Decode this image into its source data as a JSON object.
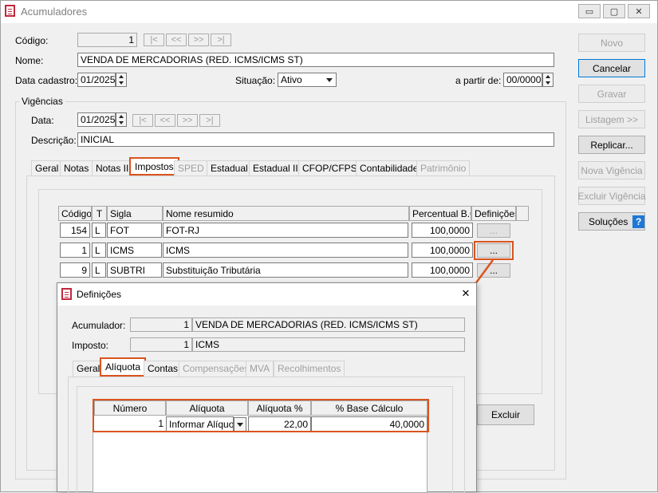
{
  "window": {
    "title": "Acumuladores",
    "controls": [
      "▭",
      "▢",
      "✕"
    ]
  },
  "form": {
    "codigo_label": "Código:",
    "codigo_value": "1",
    "nav_buttons": [
      "|<",
      "<<",
      ">>",
      ">|"
    ],
    "nome_label": "Nome:",
    "nome_value": "VENDA DE MERCADORIAS (RED. ICMS/ICMS ST)",
    "data_cadastro_label": "Data cadastro:",
    "data_cadastro_value": "01/2025",
    "situacao_label": "Situação:",
    "situacao_value": "Ativo",
    "a_partir_label": "a partir de:",
    "a_partir_value": "00/0000"
  },
  "side_buttons": {
    "novo": "Novo",
    "cancelar": "Cancelar",
    "gravar": "Gravar",
    "listagem": "Listagem >>",
    "replicar": "Replicar...",
    "nova_vigencia": "Nova Vigência",
    "excluir_vigencia": "Excluir Vigência",
    "solucoes": "Soluções",
    "help_glyph": "?"
  },
  "vigencias": {
    "group_label": "Vigências",
    "data_label": "Data:",
    "data_value": "01/2025",
    "descricao_label": "Descrição:",
    "descricao_value": "INICIAL",
    "tabs": [
      "Geral",
      "Notas",
      "Notas II",
      "Impostos",
      "SPED",
      "Estadual",
      "Estadual II",
      "CFOP/CFPS",
      "Contabilidade",
      "Patrimônio"
    ]
  },
  "impostos_table": {
    "headers": [
      "Código",
      "T",
      "Sigla",
      "Nome resumido",
      "Percentual B.C.",
      "Definições"
    ],
    "rows": [
      {
        "codigo": "154",
        "t": "L",
        "sigla": "FOT",
        "nome": "FOT-RJ",
        "percentual": "100,0000",
        "def": "..."
      },
      {
        "codigo": "1",
        "t": "L",
        "sigla": "ICMS",
        "nome": "ICMS",
        "percentual": "100,0000",
        "def": "..."
      },
      {
        "codigo": "9",
        "t": "L",
        "sigla": "SUBTRI",
        "nome": "Substituição Tributária",
        "percentual": "100,0000",
        "def": "..."
      }
    ],
    "excluir_label": "Excluir"
  },
  "dialog": {
    "title": "Definições",
    "close_glyph": "✕",
    "acumulador_label": "Acumulador:",
    "acumulador_code": "1",
    "acumulador_name": "VENDA DE MERCADORIAS (RED. ICMS/ICMS ST)",
    "imposto_label": "Imposto:",
    "imposto_code": "1",
    "imposto_name": "ICMS",
    "tabs": [
      "Geral",
      "Alíquota",
      "Contas",
      "Compensações",
      "MVA",
      "Recolhimentos"
    ],
    "grid_headers": [
      "Número",
      "Alíquota",
      "Alíquota %",
      "% Base Cálculo"
    ],
    "grid_row": {
      "numero": "1",
      "aliquota": "Informar Alíquota",
      "aliquota_pct": "22,00",
      "base": "40,0000"
    }
  },
  "colors": {
    "highlight": "#d9541e",
    "app_icon": "#c0283d"
  }
}
